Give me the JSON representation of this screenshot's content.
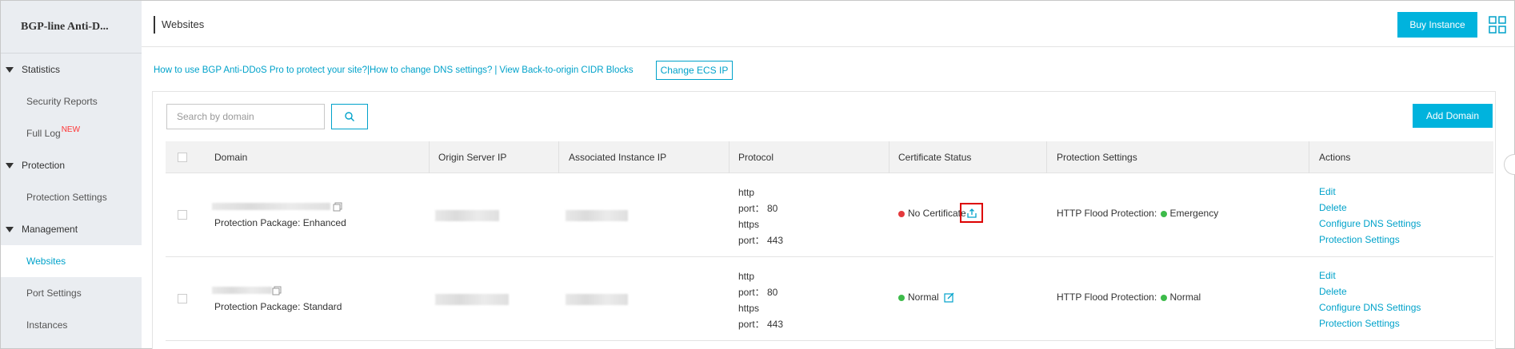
{
  "sidebar": {
    "title": "BGP-line Anti-D...",
    "groups": [
      {
        "label": "Statistics",
        "items": [
          {
            "label": "Security Reports"
          },
          {
            "label": "Full Log",
            "badge": "NEW"
          }
        ]
      },
      {
        "label": "Protection",
        "items": [
          {
            "label": "Protection Settings"
          }
        ]
      },
      {
        "label": "Management",
        "items": [
          {
            "label": "Websites",
            "active": true
          },
          {
            "label": "Port Settings"
          },
          {
            "label": "Instances"
          }
        ]
      }
    ]
  },
  "header": {
    "title": "Websites",
    "buy_label": "Buy Instance",
    "apps_icon": "grid-icon"
  },
  "links": {
    "protect": "How to use BGP Anti-DDoS Pro to protect your site?|",
    "dns": "How to change DNS settings?",
    "sep": "|",
    "cidr": "View Back-to-origin CIDR Blocks",
    "change_ecs": "Change ECS IP"
  },
  "search": {
    "placeholder": "Search by domain",
    "icon": "search-icon"
  },
  "add_domain_label": "Add Domain",
  "table": {
    "headers": [
      "Domain",
      "Origin Server IP",
      "Associated Instance IP",
      "Protocol",
      "Certificate Status",
      "Protection Settings",
      "Actions"
    ],
    "rows": [
      {
        "package": "Protection Package: Enhanced",
        "protocol": [
          "http",
          "port： 80",
          "https",
          "port： 443"
        ],
        "cert_status": "No Certificate",
        "cert_color": "#e4393c",
        "cert_icon": "upload-icon",
        "protection_label": "HTTP Flood Protection:",
        "protection_mode": "Emergency",
        "protection_color": "#3dbb4a",
        "actions": [
          "Edit",
          "Delete",
          "Configure DNS Settings",
          "Protection Settings"
        ]
      },
      {
        "package": "Protection Package: Standard",
        "protocol": [
          "http",
          "port： 80",
          "https",
          "port： 443"
        ],
        "cert_status": "Normal",
        "cert_color": "#3dbb4a",
        "cert_icon": "edit-icon",
        "protection_label": "HTTP Flood Protection:",
        "protection_mode": "Normal",
        "protection_color": "#3dbb4a",
        "actions": [
          "Edit",
          "Delete",
          "Configure DNS Settings",
          "Protection Settings"
        ]
      }
    ]
  },
  "colors": {
    "accent": "#00b3dd",
    "link": "#00a2ca",
    "sidebar_bg": "#eaedf1",
    "active_item": "#00a2ca"
  }
}
